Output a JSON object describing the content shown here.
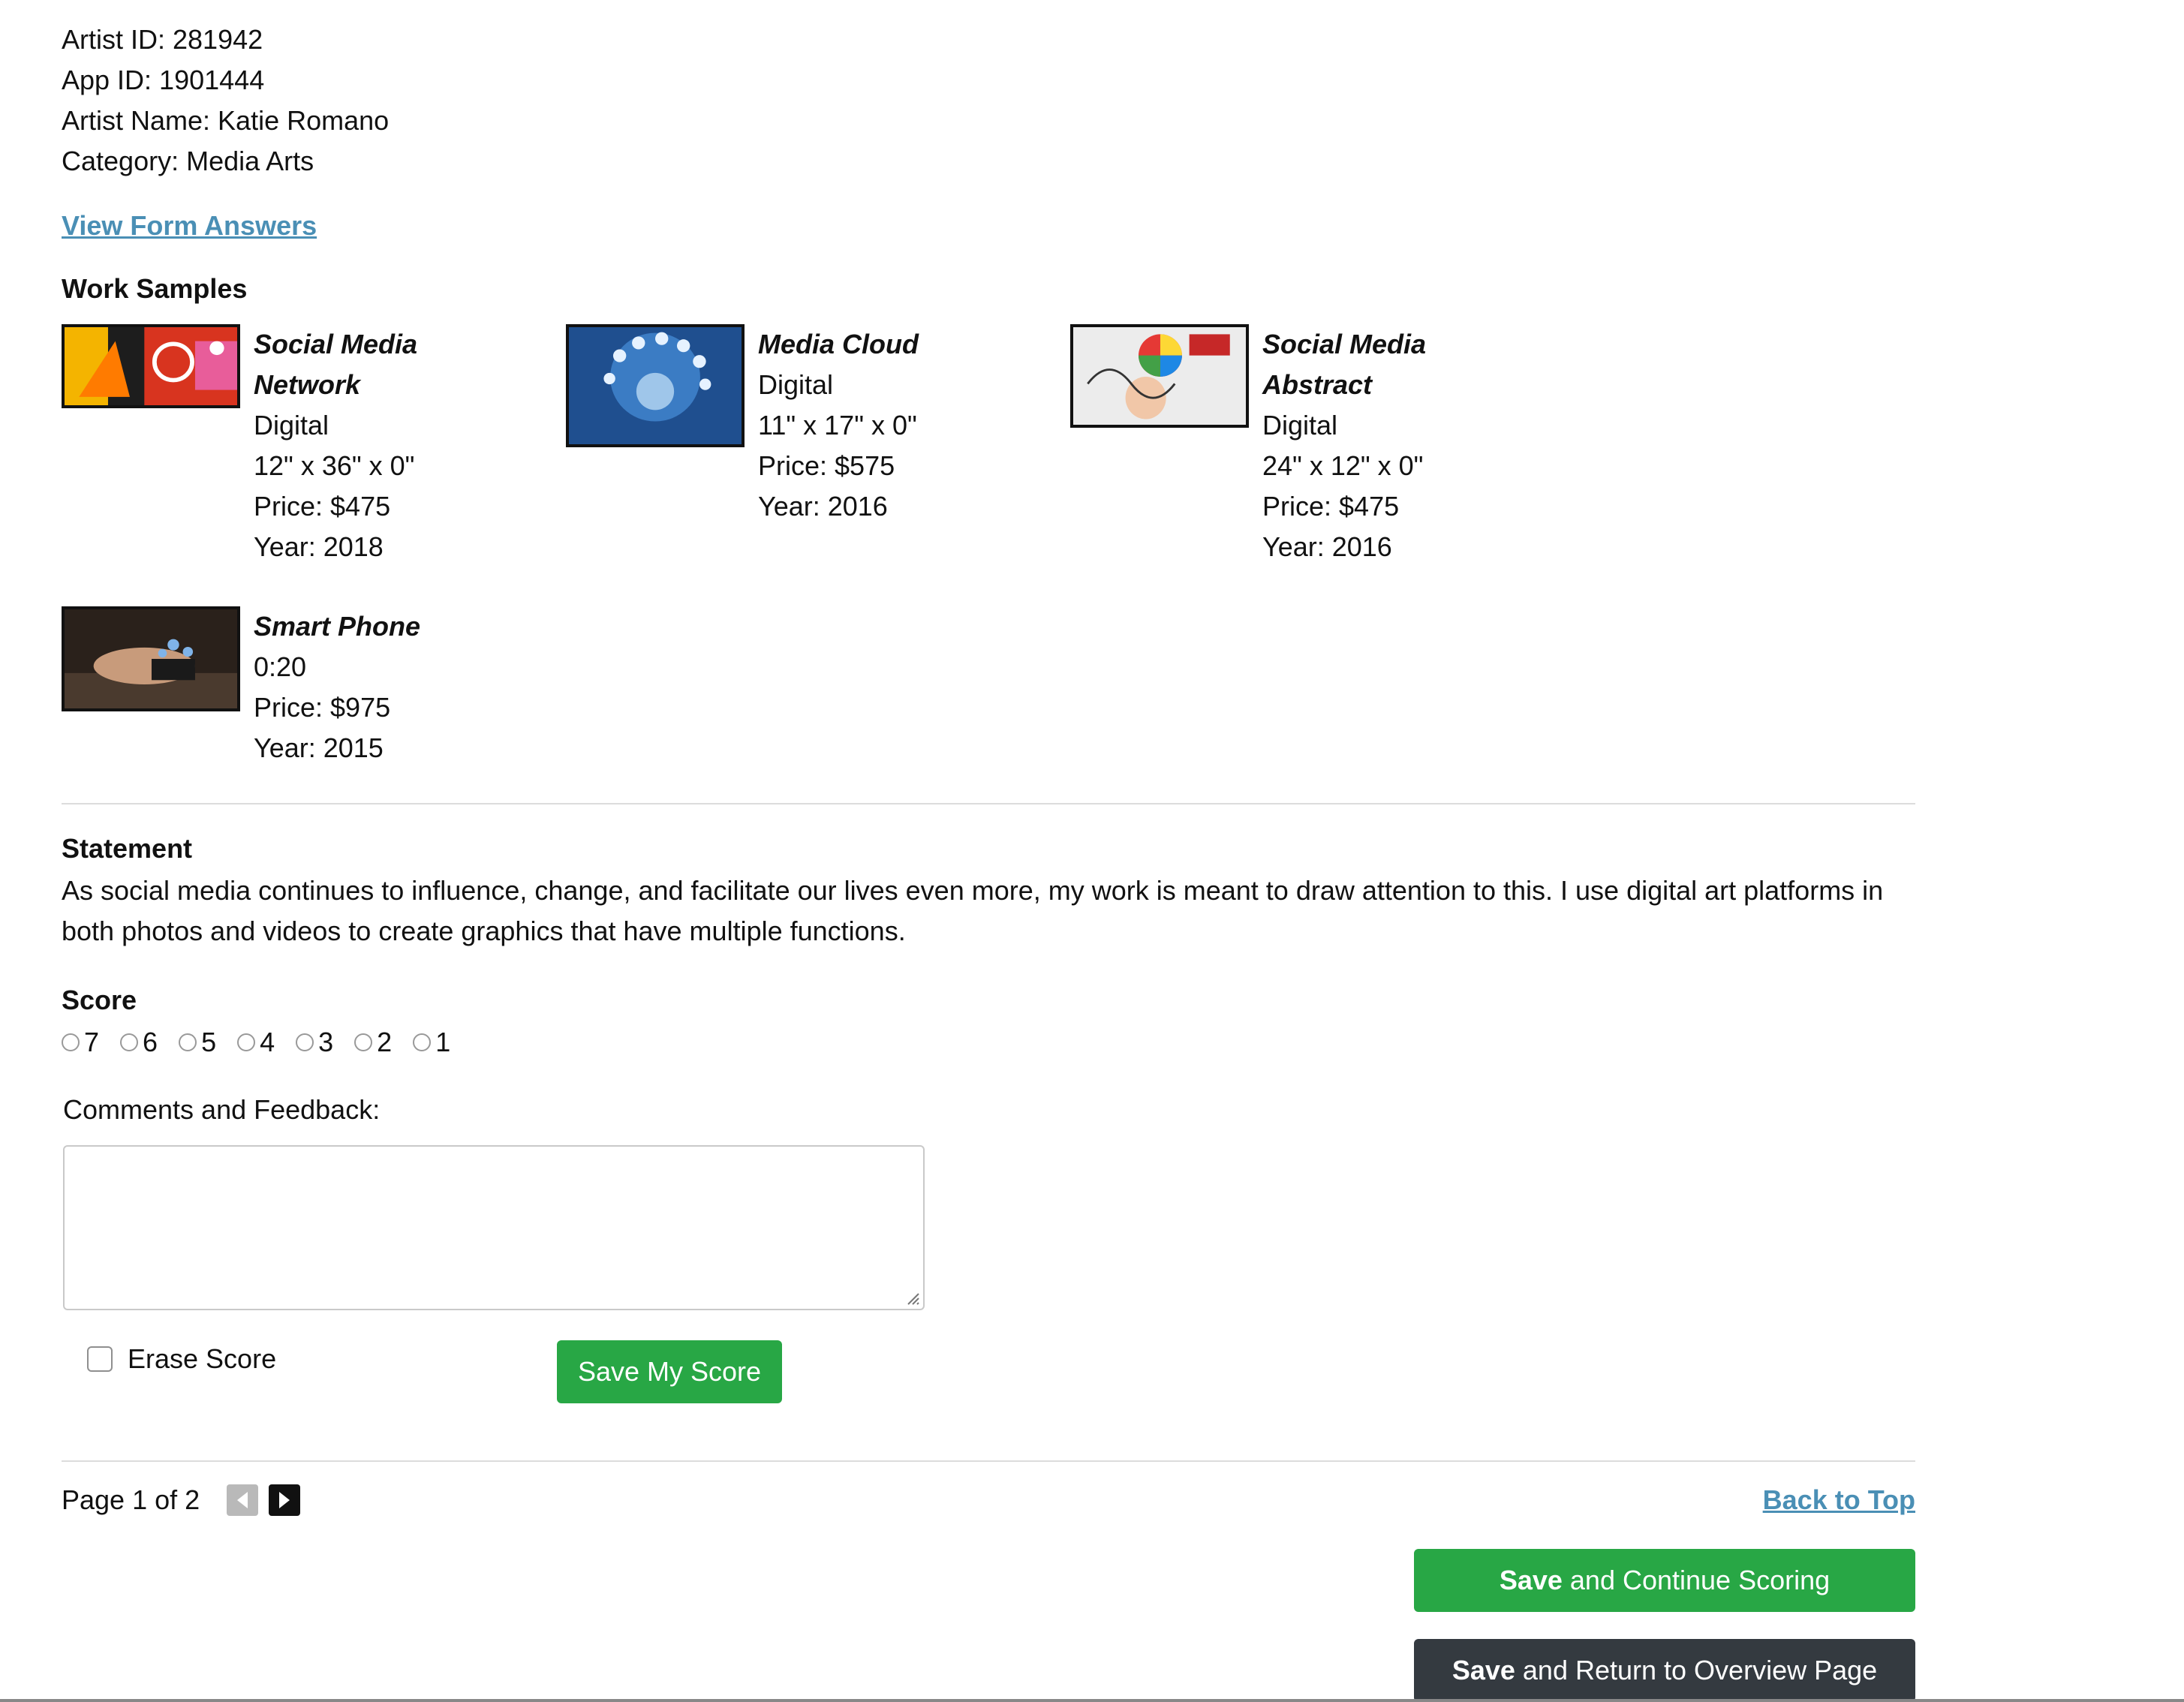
{
  "meta": {
    "artist_id": "Artist ID: 281942",
    "app_id": "App ID: 1901444",
    "artist_name": "Artist Name: Katie Romano",
    "category": "Category: Media Arts"
  },
  "view_form_answers": "View Form Answers",
  "work_samples": {
    "heading": "Work Samples",
    "items": [
      {
        "title": "Social Media Network",
        "medium": "Digital",
        "size": "12\" x 36\" x 0\"",
        "price": "Price: $475",
        "year": "Year: 2018"
      },
      {
        "title": "Media Cloud",
        "medium": "Digital",
        "size": "11\" x 17\" x 0\"",
        "price": "Price: $575",
        "year": "Year: 2016"
      },
      {
        "title": "Social Media Abstract",
        "medium": "Digital",
        "size": "24\" x 12\" x 0\"",
        "price": "Price: $475",
        "year": "Year: 2016"
      },
      {
        "title": "Smart Phone",
        "medium": "0:20",
        "price": "Price: $975",
        "year": "Year: 2015"
      }
    ]
  },
  "statement": {
    "heading": "Statement",
    "text": "As social media continues to influence, change, and facilitate our lives even more, my work is meant to draw attention to this. I use digital art platforms in both photos and videos to create graphics that have multiple functions."
  },
  "score": {
    "heading": "Score",
    "options": [
      "7",
      "6",
      "5",
      "4",
      "3",
      "2",
      "1"
    ]
  },
  "comments": {
    "label": "Comments and Feedback:",
    "value": ""
  },
  "erase_score_label": "Erase Score",
  "save_my_score_label": "Save My Score",
  "pagination": {
    "text": "Page 1 of 2"
  },
  "back_to_top": "Back to Top",
  "actions": {
    "continue_bold": "Save",
    "continue_rest": "and Continue Scoring",
    "return_bold": "Save",
    "return_rest": "and Return to Overview Page"
  },
  "colors": {
    "link": "#4a8fb5",
    "primary_green": "#28a745",
    "dark": "#343a40"
  }
}
